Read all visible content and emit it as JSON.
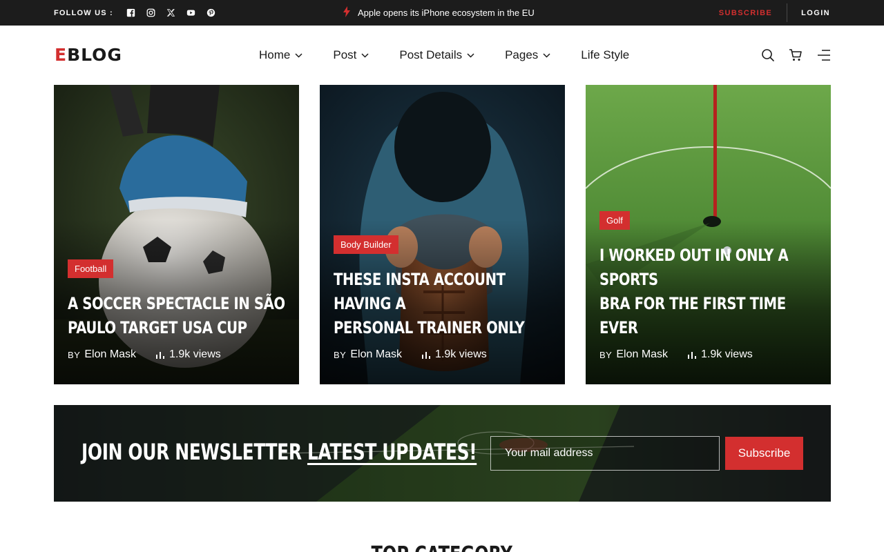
{
  "topbar": {
    "follow_label": "FOLLOW US :",
    "social_icons": [
      "facebook-icon",
      "instagram-icon",
      "x-icon",
      "youtube-icon",
      "pinterest-icon"
    ],
    "headline": "Apple opens its iPhone ecosystem in the EU",
    "subscribe_label": "SUBSCRIBE",
    "login_label": "LOGIN"
  },
  "header": {
    "logo_first": "E",
    "logo_rest": "BLOG",
    "nav": [
      {
        "label": "Home",
        "dropdown": true
      },
      {
        "label": "Post",
        "dropdown": true
      },
      {
        "label": "Post Details",
        "dropdown": true
      },
      {
        "label": "Pages",
        "dropdown": true
      },
      {
        "label": "Life Style",
        "dropdown": false
      }
    ],
    "icons": [
      "search-icon",
      "cart-icon",
      "menu-icon"
    ]
  },
  "cards": [
    {
      "category": "Football",
      "title": "A Soccer Spectacle in São\nPaulo Target USA Cup",
      "by": "BY",
      "author": "Elon Mask",
      "views": "1.9k views"
    },
    {
      "category": "Body Builder",
      "title": "These Insta Account Having a\nPersonal Trainer Only",
      "by": "BY",
      "author": "Elon Mask",
      "views": "1.9k views"
    },
    {
      "category": "Golf",
      "title": "I Worked Out in Only a\nSports\nBra for the First Time Ever",
      "by": "BY",
      "author": "Elon Mask",
      "views": "1.9k views"
    }
  ],
  "newsletter": {
    "title_plain": "Join Our Newsletter ",
    "title_underlined": "Latest Updates!",
    "input_placeholder": "Your mail address",
    "button_label": "Subscribe"
  },
  "section": {
    "title": "Top Category"
  },
  "colors": {
    "accent": "#d32f2f",
    "topbar_bg": "#1c1c1c"
  }
}
